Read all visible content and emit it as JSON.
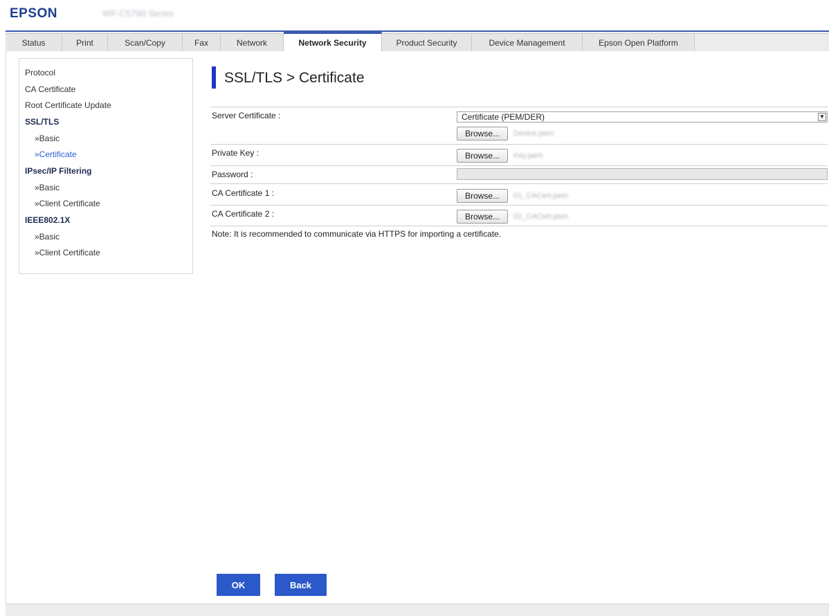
{
  "header": {
    "logo": "EPSON",
    "model": "WF-C5790 Series"
  },
  "tabs": [
    {
      "label": "Status"
    },
    {
      "label": "Print"
    },
    {
      "label": "Scan/Copy"
    },
    {
      "label": "Fax"
    },
    {
      "label": "Network"
    },
    {
      "label": "Network Security",
      "active": true
    },
    {
      "label": "Product Security"
    },
    {
      "label": "Device Management"
    },
    {
      "label": "Epson Open Platform"
    }
  ],
  "sidebar": {
    "items": [
      {
        "label": "Protocol"
      },
      {
        "label": "CA Certificate"
      },
      {
        "label": "Root Certificate Update"
      },
      {
        "label": "SSL/TLS"
      },
      {
        "label": "»Basic"
      },
      {
        "label": "»Certificate"
      },
      {
        "label": "IPsec/IP Filtering"
      },
      {
        "label": "»Basic"
      },
      {
        "label": "»Client Certificate"
      },
      {
        "label": "IEEE802.1X"
      },
      {
        "label": "»Basic"
      },
      {
        "label": "»Client Certificate"
      }
    ]
  },
  "main": {
    "title": "SSL/TLS > Certificate",
    "server_certificate": {
      "label": "Server Certificate :",
      "format_value": "Certificate (PEM/DER)",
      "browse_label": "Browse...",
      "file_name": "Device.pem"
    },
    "private_key": {
      "label": "Private Key :",
      "browse_label": "Browse...",
      "file_name": "Key.pem"
    },
    "password": {
      "label": "Password :",
      "value": ""
    },
    "ca_certificate_1": {
      "label": "CA Certificate 1 :",
      "browse_label": "Browse...",
      "file_name": "01_CACert.pem"
    },
    "ca_certificate_2": {
      "label": "CA Certificate 2 :",
      "browse_label": "Browse...",
      "file_name": "02_CACert.pem"
    },
    "note": "Note: It is recommended to communicate via HTTPS for importing a certificate."
  },
  "buttons": {
    "ok_label": "OK",
    "back_label": "Back"
  },
  "colors": {
    "accent": "#2c59c9",
    "tab_accent": "#3b5bb0",
    "logo": "#1d3f8f"
  }
}
